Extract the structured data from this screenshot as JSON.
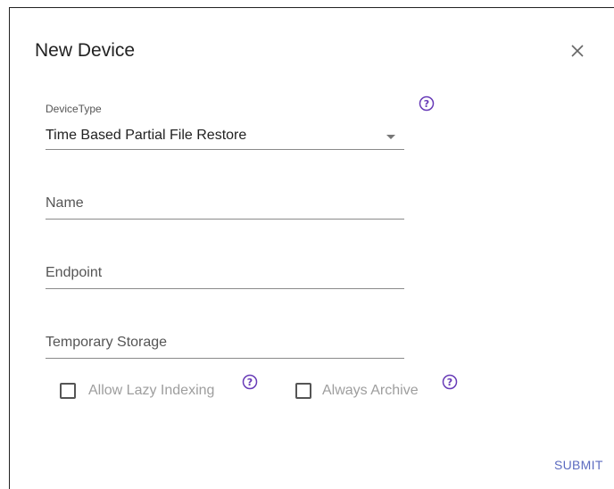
{
  "dialog": {
    "title": "New Device",
    "close_icon": "close-icon",
    "submit_label": "SUBMIT",
    "accent_color": "#5c6bc0",
    "help_icon_color": "#673ab7"
  },
  "form": {
    "device_type": {
      "label": "DeviceType",
      "value": "Time Based Partial File Restore",
      "icon": "chevron-down-icon"
    },
    "name": {
      "placeholder": "Name"
    },
    "endpoint": {
      "placeholder": "Endpoint"
    },
    "temporary_storage": {
      "placeholder": "Temporary Storage"
    },
    "checkboxes": [
      {
        "label": "Allow Lazy Indexing",
        "checked": false
      },
      {
        "label": "Always Archive",
        "checked": false
      }
    ]
  }
}
